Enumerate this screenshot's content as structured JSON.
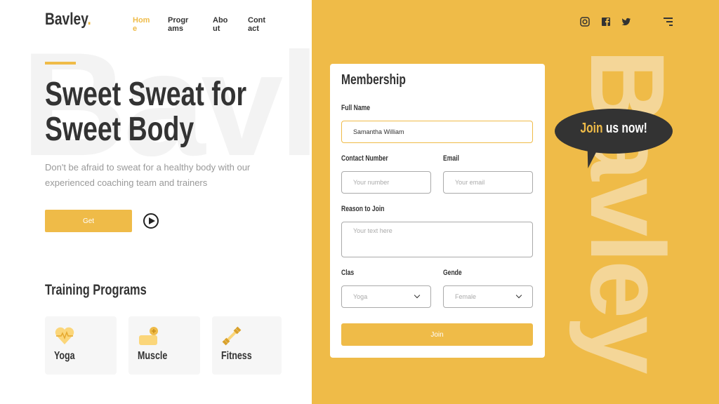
{
  "brand": {
    "name": "Bavley",
    "dot": ".",
    "watermark": "Bavley"
  },
  "nav": [
    {
      "label": "Home",
      "active": true
    },
    {
      "label": "Programs"
    },
    {
      "label": "About"
    },
    {
      "label": "Contact"
    }
  ],
  "hero": {
    "title_line1": "Sweet Sweat for",
    "title_line2": "Sweet Body",
    "subtitle": "Don't be afraid to sweat for a healthy body with our experienced coaching team and trainers",
    "cta": "Get",
    "play_icon": "play-circle-icon"
  },
  "training": {
    "heading": "Training Programs",
    "cards": [
      {
        "label": "Yoga",
        "icon": "heart-pulse-icon"
      },
      {
        "label": "Muscle",
        "icon": "flexed-arm-icon"
      },
      {
        "label": "Fitness",
        "icon": "dumbbell-icon"
      }
    ]
  },
  "social": [
    "instagram-icon",
    "facebook-icon",
    "twitter-icon"
  ],
  "bubble": {
    "highlight": "Join",
    "rest": " us now!"
  },
  "form": {
    "title": "Membership",
    "full_name": {
      "label": "Full Name",
      "value": "Samantha William"
    },
    "contact": {
      "label": "Contact Number",
      "placeholder": "Your number"
    },
    "email": {
      "label": "Email",
      "placeholder": "Your email"
    },
    "reason": {
      "label": "Reason to Join",
      "placeholder": "Your text here"
    },
    "class": {
      "label": "Clas",
      "value": "Yoga"
    },
    "gender": {
      "label": "Gende",
      "value": "Female"
    },
    "submit": "Join"
  },
  "colors": {
    "accent": "#efbb48",
    "dark": "#333333"
  }
}
